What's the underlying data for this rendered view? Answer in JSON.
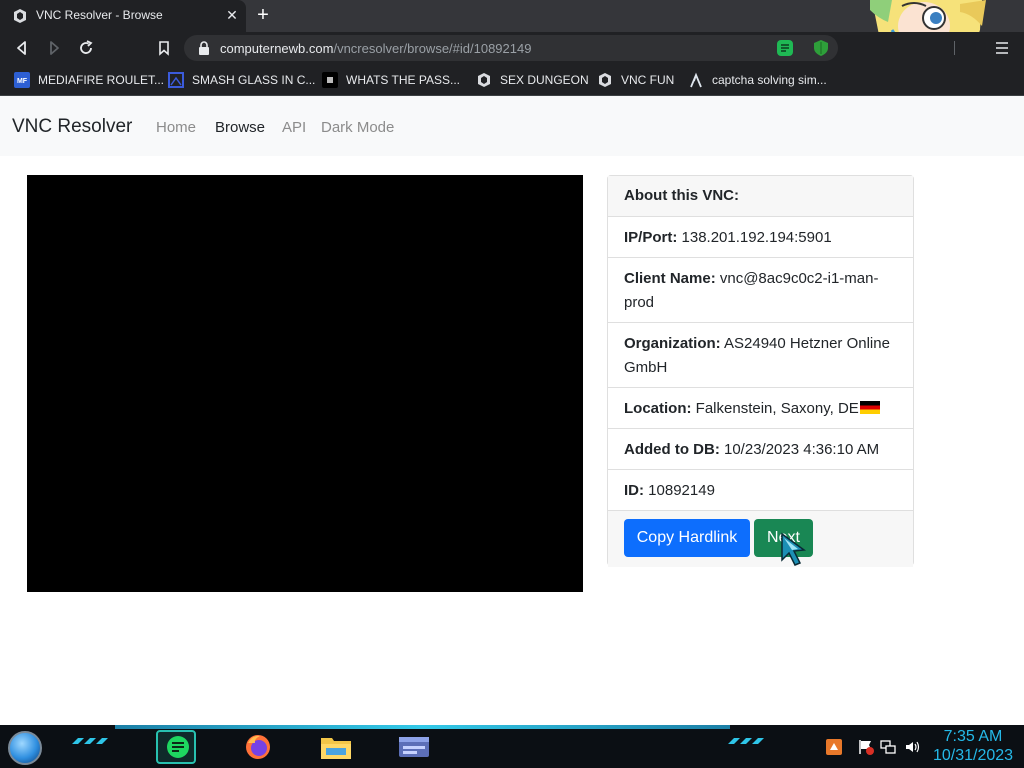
{
  "browser": {
    "tab": {
      "title": "VNC Resolver - Browse",
      "close_glyph": "✕",
      "favicon": "vnc-logo-icon"
    },
    "new_tab_glyph": "+",
    "url": {
      "domain": "computernewb.com",
      "path": "/vncresolver/browse/#id/10892149"
    },
    "bookmarks": [
      {
        "label": "MEDIAFIRE ROULET...",
        "icon": "mediafire-icon"
      },
      {
        "label": "SMASH GLASS IN C...",
        "icon": "glass-icon"
      },
      {
        "label": "WHATS THE PASS...",
        "icon": "dark-site-icon"
      },
      {
        "label": "SEX DUNGEON",
        "icon": "vnc-logo-icon"
      },
      {
        "label": "VNC FUN",
        "icon": "vnc-logo-icon"
      },
      {
        "label": "captcha solving sim...",
        "icon": "lambda-icon"
      }
    ]
  },
  "site": {
    "brand": "VNC Resolver",
    "nav": [
      "Home",
      "Browse",
      "API",
      "Dark Mode"
    ],
    "active_nav": "Browse"
  },
  "card": {
    "header": "About this VNC:",
    "ip_label": "IP/Port:",
    "ip_value": "138.201.192.194:5901",
    "client_label": "Client Name:",
    "client_value": "vnc@8ac9c0c2-i1-man-prod",
    "org_label": "Organization:",
    "org_value": "AS24940 Hetzner Online GmbH",
    "location_label": "Location:",
    "location_value": "Falkenstein, Saxony, DE",
    "added_label": "Added to DB:",
    "added_value": "10/23/2023 4:36:10 AM",
    "id_label": "ID:",
    "id_value": "10892149",
    "copy_button": "Copy Hardlink",
    "next_button": "Next"
  },
  "taskbar": {
    "time": "7:35 AM",
    "date": "10/31/2023",
    "apps": [
      "spotify-icon",
      "firefox-icon",
      "file-explorer-icon",
      "terminal-icon"
    ]
  },
  "colors": {
    "primary": "#0d6efd",
    "success": "#198754",
    "chrome_dark": "#202124",
    "clock": "#25b9e8"
  }
}
